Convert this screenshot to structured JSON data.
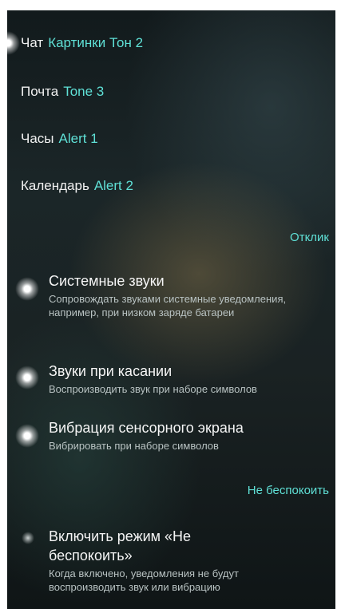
{
  "ringtones": [
    {
      "label": "Чат",
      "value": "Картинки Тон 2"
    },
    {
      "label": "Почта",
      "value": "Tone 3"
    },
    {
      "label": "Часы",
      "value": "Alert 1"
    },
    {
      "label": "Календарь",
      "value": "Alert 2"
    }
  ],
  "feedback": {
    "header": "Отклик",
    "items": [
      {
        "title": "Системные звуки",
        "description": "Сопровождать звуками системные уведомления, например, при низком заряде батареи",
        "enabled": true
      },
      {
        "title": "Звуки при касании",
        "description": "Воспроизводить звук при наборе символов",
        "enabled": true
      },
      {
        "title": "Вибрация сенсорного экрана",
        "description": "Вибрировать при наборе символов",
        "enabled": true
      }
    ]
  },
  "do_not_disturb": {
    "header": "Не беспокоить",
    "item": {
      "title": "Включить режим «Не беспокоить»",
      "description": "Когда включено, уведомления не будут воспроизводить звук или вибрацию",
      "enabled": false
    }
  },
  "colors": {
    "accent": "#5fe0d6",
    "text_primary": "#f2f2f2",
    "text_secondary": "#b8c2c2",
    "background": "#1b2628"
  }
}
